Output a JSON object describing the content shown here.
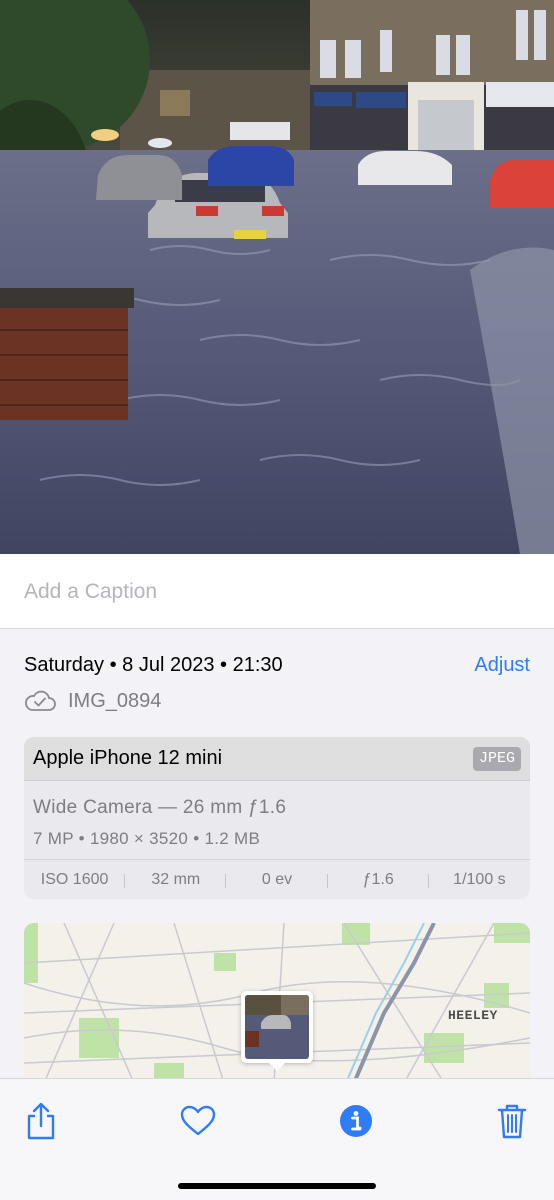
{
  "caption": {
    "placeholder": "Add a Caption"
  },
  "details": {
    "date": "Saturday • 8 Jul 2023 • 21:30",
    "adjust_label": "Adjust",
    "filename": "IMG_0894",
    "cloud_icon": "icloud-icon"
  },
  "camera": {
    "device": "Apple iPhone 12 mini",
    "format": "JPEG",
    "lens": "Wide Camera — 26 mm ƒ1.6",
    "specs": "7 MP  •  1980 × 3520  •  1.2 MB",
    "exif": [
      "ISO 1600",
      "32 mm",
      "0 ev",
      "ƒ1.6",
      "1/100 s"
    ]
  },
  "map": {
    "place_label": "HEELEY"
  },
  "toolbar": {
    "share_icon": "share-icon",
    "favorite_icon": "heart-icon",
    "info_icon": "info-icon",
    "delete_icon": "trash-icon"
  },
  "colors": {
    "accent": "#2f7cf6",
    "secondary_text": "#7d7d82",
    "background": "#f2f2f7"
  }
}
